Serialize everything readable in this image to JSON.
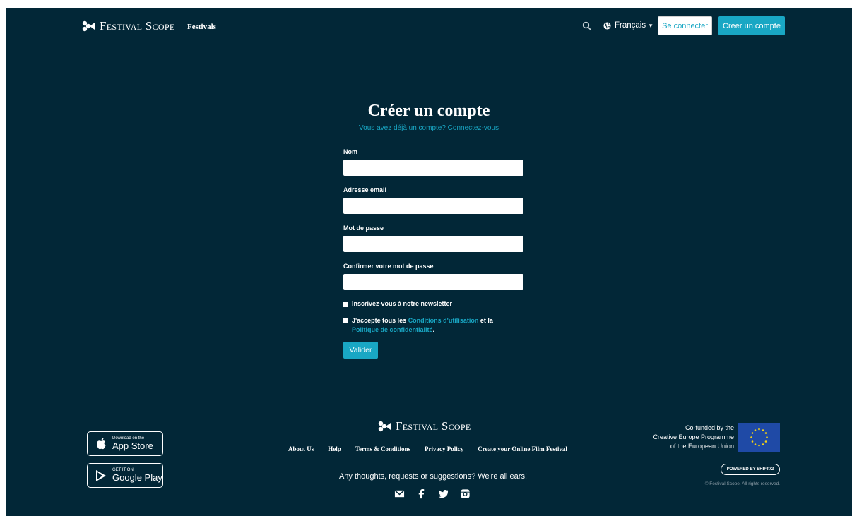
{
  "header": {
    "brand": "Festival Scope",
    "nav_festivals": "Festivals",
    "language": "Français",
    "login_button": "Se connecter",
    "signup_button": "Créer un compte"
  },
  "form": {
    "title": "Créer un compte",
    "login_link": "Vous avez déjà un compte? Connectez-vous",
    "fields": [
      {
        "label": "Nom",
        "value": ""
      },
      {
        "label": "Adresse email",
        "value": ""
      },
      {
        "label": "Mot de passe",
        "value": ""
      },
      {
        "label": "Confirmer votre mot de passe",
        "value": ""
      }
    ],
    "newsletter_label": "Inscrivez-vous à notre newsletter",
    "terms": {
      "prefix": "J'accepte tous les ",
      "conditions_link": "Conditions d'utilisation",
      "middle": " et la ",
      "privacy_link": "Politique de confidentialité",
      "suffix": "."
    },
    "submit_button": "Valider"
  },
  "store_badges": {
    "appstore_small": "Download on the",
    "appstore_big": "App Store",
    "googleplay_small": "GET IT ON",
    "googleplay_big": "Google Play"
  },
  "footer": {
    "brand": "Festival Scope",
    "links": [
      "About Us",
      "Help",
      "Terms & Conditions",
      "Privacy Policy",
      "Create your Online Film Festival"
    ],
    "message": "Any thoughts, requests or suggestions? We're all ears!",
    "social_icons": [
      "envelope-icon",
      "facebook-icon",
      "twitter-icon",
      "instagram-icon"
    ],
    "eu_text": [
      "Co-funded by the",
      "Creative Europe Programme",
      "of the European Union"
    ],
    "powered_by": "POWERED BY SHIFT72",
    "copyright": "© Festival Scope. All rights reserved."
  },
  "colors": {
    "background": "#022737",
    "accent": "#19a7c4",
    "eu_flag": "#1f4aa6"
  }
}
